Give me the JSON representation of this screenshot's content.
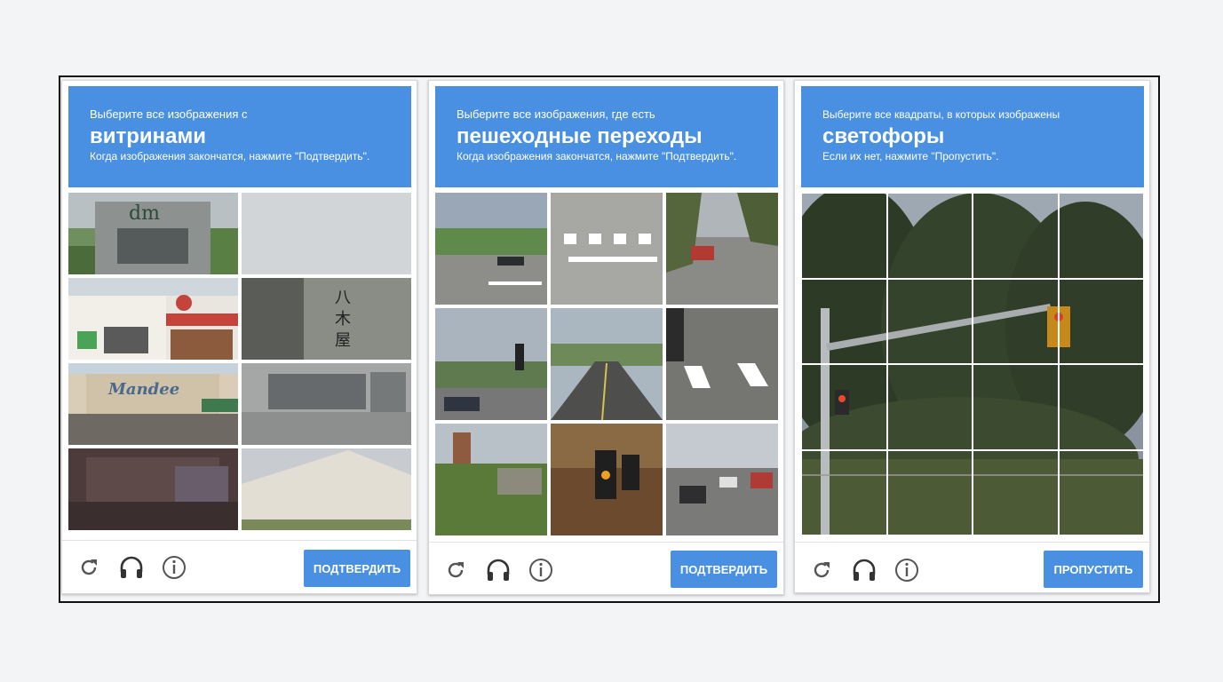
{
  "accent_color": "#4a90e2",
  "widgets": [
    {
      "instruction": "Выберите все изображения с",
      "target": "витринами",
      "hint": "Когда изображения закончатся, нажмите \"Подтвердить\".",
      "button": "ПОДТВЕРДИТЬ",
      "tiles": [
        "dm storefront",
        "blank sky",
        "shop with striped awning",
        "sign with characters",
        "Mandee store",
        "garage building",
        "fenced patio",
        "white warehouse"
      ]
    },
    {
      "instruction": "Выберите все изображения, где есть",
      "target": "пешеходные переходы",
      "hint": "Когда изображения закончатся, нажмите \"Подтвердить\".",
      "button": "ПОДТВЕРДИТЬ",
      "tiles": [
        "intersection",
        "crosswalk",
        "street with red car",
        "street with traffic light",
        "road with cars",
        "crosswalk close-up",
        "industrial view",
        "traffic light at night",
        "highway traffic"
      ]
    },
    {
      "instruction": "Выберите все квадраты, в которых изображены",
      "target": "светофоры",
      "hint": "Если их нет, нажмите \"Пропустить\".",
      "button": "ПРОПУСТИТЬ"
    }
  ],
  "icons": {
    "reload": "reload-icon",
    "audio": "headphones-icon",
    "info": "info-icon"
  }
}
